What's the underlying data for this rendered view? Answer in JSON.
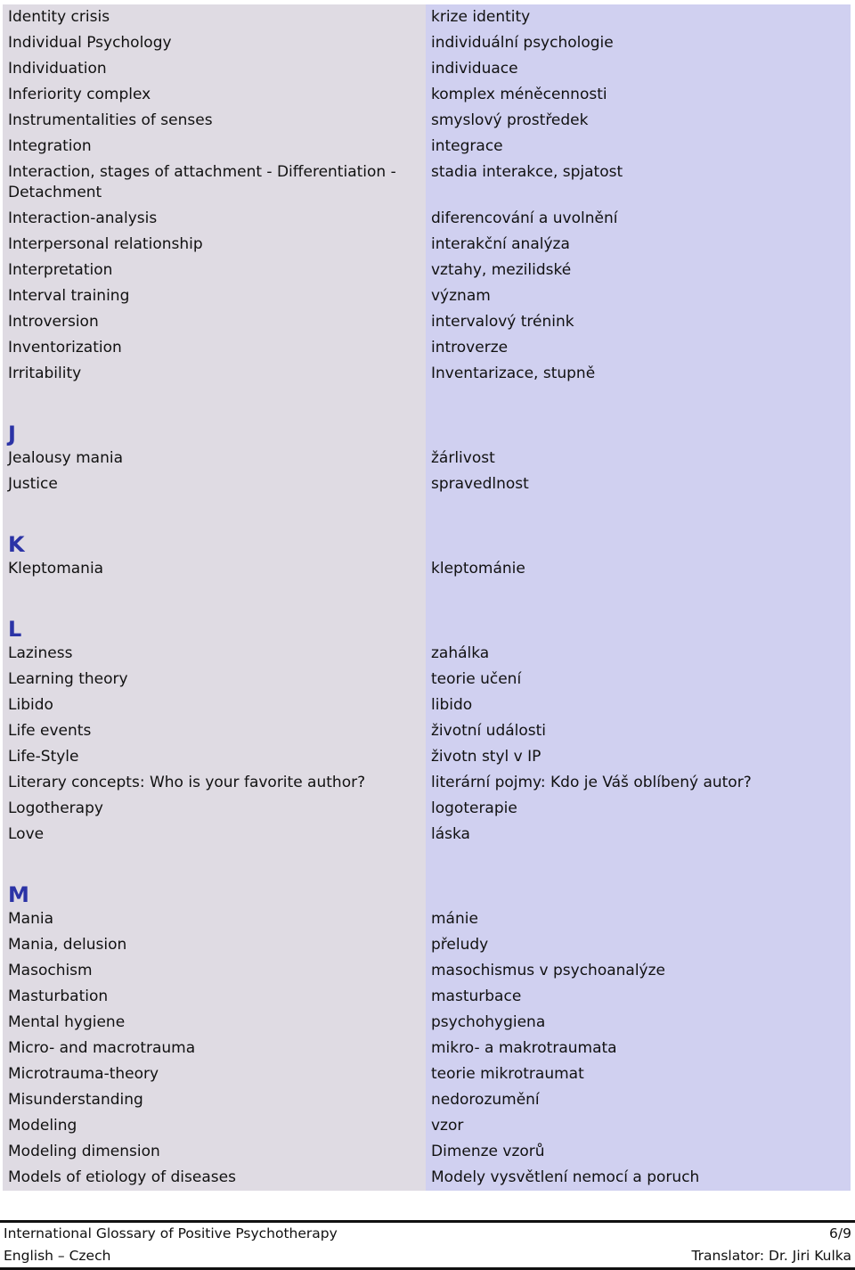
{
  "sections": [
    {
      "letter": "",
      "rows": [
        [
          "Identity crisis",
          "krize identity"
        ],
        [
          "Individual Psychology",
          "individuální psychologie"
        ],
        [
          "Individuation",
          "individuace"
        ],
        [
          "Inferiority complex",
          "komplex méněcennosti"
        ],
        [
          "Instrumentalities of senses",
          "smyslový prostředek"
        ],
        [
          "Integration",
          "integrace"
        ],
        [
          "Interaction, stages of attachment - Differentiation - Detachment",
          "stadia interakce, spjatost"
        ],
        [
          "Interaction-analysis",
          "diferencování a uvolnění"
        ],
        [
          "Interpersonal relationship",
          "interakční analýza"
        ],
        [
          "Interpretation",
          "vztahy, mezilidské"
        ],
        [
          "Interval training",
          "význam"
        ],
        [
          "Introversion",
          "intervalový trénink"
        ],
        [
          "Inventorization",
          "introverze"
        ],
        [
          "Irritability",
          "Inventarizace, stupně"
        ]
      ]
    },
    {
      "letter": "J",
      "rows": [
        [
          "Jealousy mania",
          "žárlivost"
        ],
        [
          "Justice",
          "spravedlnost"
        ]
      ]
    },
    {
      "letter": "K",
      "rows": [
        [
          "Kleptomania",
          "kleptománie"
        ]
      ]
    },
    {
      "letter": "L",
      "rows": [
        [
          "Laziness",
          "zahálka"
        ],
        [
          "Learning theory",
          "teorie učení"
        ],
        [
          "Libido",
          "libido"
        ],
        [
          "Life events",
          "životní události"
        ],
        [
          "Life-Style",
          "životn styl v IP"
        ],
        [
          "Literary concepts: Who is your favorite author?",
          "literární pojmy: Kdo je Váš oblíbený autor?"
        ],
        [
          "Logotherapy",
          "logoterapie"
        ],
        [
          "Love",
          "láska"
        ]
      ]
    },
    {
      "letter": "M",
      "rows": [
        [
          "Mania",
          "mánie"
        ],
        [
          "Mania, delusion",
          "přeludy"
        ],
        [
          "Masochism",
          "masochismus v psychoanalýze"
        ],
        [
          "Masturbation",
          "masturbace"
        ],
        [
          "Mental hygiene",
          "psychohygiena"
        ],
        [
          "Micro- and macrotrauma",
          "mikro- a makrotraumata"
        ],
        [
          "Microtrauma-theory",
          "teorie mikrotraumat"
        ],
        [
          "Misunderstanding",
          "nedorozumění"
        ],
        [
          "Modeling",
          "vzor"
        ],
        [
          "Modeling dimension",
          "Dimenze vzorů"
        ],
        [
          "Models of etiology of diseases",
          "Modely vysvětlení nemocí a poruch"
        ]
      ]
    }
  ],
  "footer": {
    "title": "International Glossary of Positive Psychotherapy",
    "page": "6/9",
    "languages": "English – Czech",
    "translator": "Translator: Dr. Jiri Kulka"
  }
}
